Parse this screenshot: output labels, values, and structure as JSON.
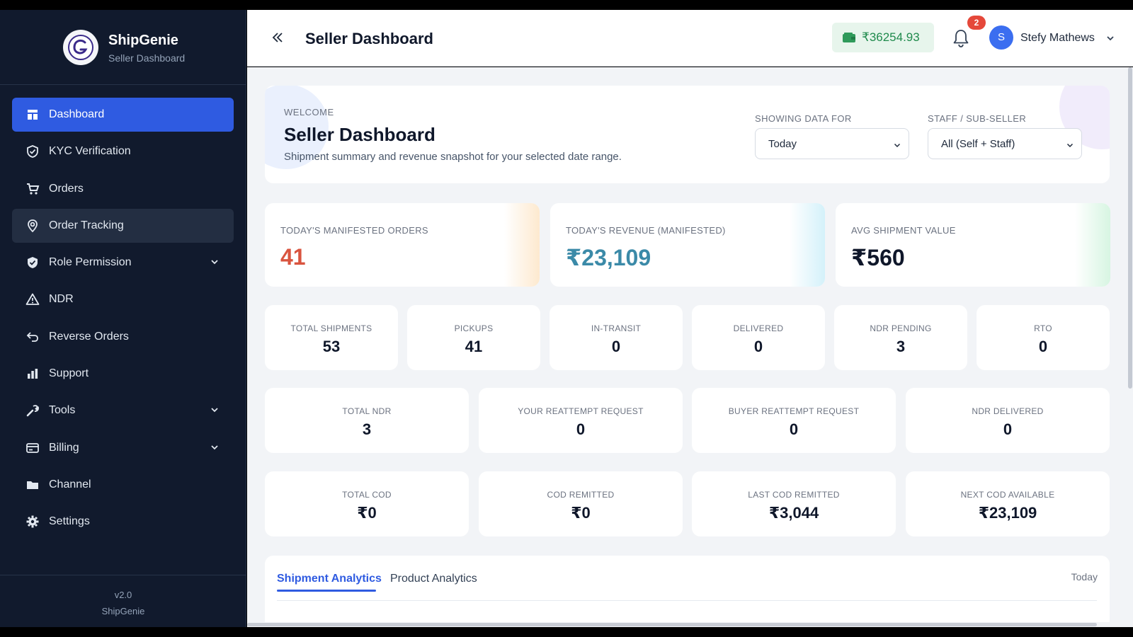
{
  "brand": {
    "name": "ShipGenie",
    "subtitle": "Seller Dashboard",
    "version": "v2.0",
    "footer_name": "ShipGenie"
  },
  "nav": [
    {
      "label": "Dashboard",
      "icon": "dashboard-icon",
      "active": true
    },
    {
      "label": "KYC Verification",
      "icon": "shield-check-icon"
    },
    {
      "label": "Orders",
      "icon": "cart-icon"
    },
    {
      "label": "Order Tracking",
      "icon": "location-pin-icon",
      "hover": true
    },
    {
      "label": "Role Permission",
      "icon": "shield-icon",
      "has_submenu": true
    },
    {
      "label": "NDR",
      "icon": "warning-icon"
    },
    {
      "label": "Reverse Orders",
      "icon": "return-icon"
    },
    {
      "label": "Support",
      "icon": "bar-chart-icon"
    },
    {
      "label": "Tools",
      "icon": "wrench-icon",
      "has_submenu": true
    },
    {
      "label": "Billing",
      "icon": "billing-icon",
      "has_submenu": true
    },
    {
      "label": "Channel",
      "icon": "folder-icon"
    },
    {
      "label": "Settings",
      "icon": "gear-icon"
    }
  ],
  "header": {
    "title": "Seller Dashboard",
    "wallet_balance": "₹36254.93",
    "notification_count": "2",
    "user_initial": "S",
    "user_name": "Stefy Mathews"
  },
  "welcome": {
    "kicker": "WELCOME",
    "title": "Seller Dashboard",
    "subtitle": "Shipment summary and revenue snapshot for your selected date range.",
    "filter_date_label": "SHOWING DATA FOR",
    "filter_date_value": "Today",
    "filter_staff_label": "STAFF / SUB-SELLER",
    "filter_staff_value": "All (Self + Staff)"
  },
  "kpis": [
    {
      "label": "TODAY'S MANIFESTED ORDERS",
      "value": "41",
      "color": "#d9543f"
    },
    {
      "label": "TODAY'S REVENUE (MANIFESTED)",
      "value": "₹23,109",
      "color": "#3b8aa8"
    },
    {
      "label": "AVG SHIPMENT VALUE",
      "value": "₹560",
      "color": "#0f172a"
    }
  ],
  "shipment_stats": [
    {
      "label": "TOTAL SHIPMENTS",
      "value": "53"
    },
    {
      "label": "PICKUPS",
      "value": "41"
    },
    {
      "label": "IN-TRANSIT",
      "value": "0"
    },
    {
      "label": "DELIVERED",
      "value": "0"
    },
    {
      "label": "NDR PENDING",
      "value": "3"
    },
    {
      "label": "RTO",
      "value": "0"
    }
  ],
  "ndr_stats": [
    {
      "label": "TOTAL NDR",
      "value": "3"
    },
    {
      "label": "YOUR REATTEMPT REQUEST",
      "value": "0"
    },
    {
      "label": "BUYER REATTEMPT REQUEST",
      "value": "0"
    },
    {
      "label": "NDR DELIVERED",
      "value": "0"
    }
  ],
  "cod_stats": [
    {
      "label": "TOTAL COD",
      "value": "₹0"
    },
    {
      "label": "COD REMITTED",
      "value": "₹0"
    },
    {
      "label": "LAST COD REMITTED",
      "value": "₹3,044"
    },
    {
      "label": "NEXT COD AVAILABLE",
      "value": "₹23,109"
    }
  ],
  "analytics": {
    "tab_shipment": "Shipment Analytics",
    "tab_product": "Product Analytics",
    "range": "Today"
  },
  "colors": {
    "accent": "#2f5be1",
    "sidebar": "#111a2d",
    "wallet_text": "#1f8a4c",
    "badge": "#e5483a"
  }
}
